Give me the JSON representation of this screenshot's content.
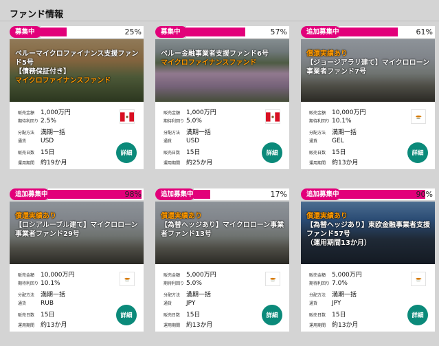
{
  "page_title": "ファンド情報",
  "detail_label": "詳細",
  "cards": [
    {
      "status": "募集中",
      "progress": 25,
      "progress_label": "25%",
      "caption_white_1": "ペルーマイクロファイナンス支援ファンド5号",
      "caption_white_2": "【債務保証付き】",
      "caption_orange_top": "",
      "caption_orange_bottom": "マイクロファイナンスファンド",
      "flag": "peru-flag",
      "rows": [
        {
          "key": "販売金額",
          "value": "1,000万円"
        },
        {
          "key": "期待利回り",
          "value": "2.5%"
        },
        {
          "key": "分配方法",
          "value": "満期一括"
        },
        {
          "key": "通貨",
          "value": "USD"
        },
        {
          "key": "販売日数",
          "value": "15日"
        },
        {
          "key": "運用期間",
          "value": "約19か月"
        }
      ]
    },
    {
      "status": "募集中",
      "progress": 57,
      "progress_label": "57%",
      "caption_white_1": "ペルー金融事業者支援ファンド6号",
      "caption_white_2": "",
      "caption_orange_top": "",
      "caption_orange_bottom": "マイクロファイナンスファンド",
      "flag": "peru-flag",
      "rows": [
        {
          "key": "販売金額",
          "value": "1,000万円"
        },
        {
          "key": "期待利回り",
          "value": "5.0%"
        },
        {
          "key": "分配方法",
          "value": "満期一括"
        },
        {
          "key": "通貨",
          "value": "USD"
        },
        {
          "key": "販売日数",
          "value": "15日"
        },
        {
          "key": "運用期間",
          "value": "約25か月"
        }
      ]
    },
    {
      "status": "追加募集中",
      "progress": 61,
      "progress_label": "61%",
      "caption_orange_top": "償還実績あり",
      "caption_white_1": "【ジョージアラリ建て】マイクロローン事業者ファンド7号",
      "caption_white_2": "",
      "caption_orange_bottom": "",
      "flag": "cyprus-flag",
      "rows": [
        {
          "key": "販売金額",
          "value": "10,000万円"
        },
        {
          "key": "期待利回り",
          "value": "10.1%"
        },
        {
          "key": "分配方法",
          "value": "満期一括"
        },
        {
          "key": "通貨",
          "value": "GEL"
        },
        {
          "key": "販売日数",
          "value": "15日"
        },
        {
          "key": "運用期間",
          "value": "約13か月"
        }
      ]
    },
    {
      "status": "追加募集中",
      "progress": 98,
      "progress_label": "98%",
      "caption_orange_top": "償還実績あり",
      "caption_white_1": "【ロシアルーブル建て】マイクロローン事業者ファンド29号",
      "caption_white_2": "",
      "caption_orange_bottom": "",
      "flag": "cyprus-flag",
      "rows": [
        {
          "key": "販売金額",
          "value": "10,000万円"
        },
        {
          "key": "期待利回り",
          "value": "10.1%"
        },
        {
          "key": "分配方法",
          "value": "満期一括"
        },
        {
          "key": "通貨",
          "value": "RUB"
        },
        {
          "key": "販売日数",
          "value": "15日"
        },
        {
          "key": "運用期間",
          "value": "約13か月"
        }
      ]
    },
    {
      "status": "追加募集中",
      "progress": 17,
      "progress_label": "17%",
      "caption_orange_top": "償還実績あり",
      "caption_white_1": "【為替ヘッジあり】マイクロローン事業者ファンド13号",
      "caption_white_2": "",
      "caption_orange_bottom": "",
      "flag": "cyprus-flag",
      "rows": [
        {
          "key": "販売金額",
          "value": "5,000万円"
        },
        {
          "key": "期待利回り",
          "value": "5.0%"
        },
        {
          "key": "分配方法",
          "value": "満期一括"
        },
        {
          "key": "通貨",
          "value": "JPY"
        },
        {
          "key": "販売日数",
          "value": "15日"
        },
        {
          "key": "運用期間",
          "value": "約13か月"
        }
      ]
    },
    {
      "status": "追加募集中",
      "progress": 90,
      "progress_label": "90%",
      "caption_orange_top": "償還実績あり",
      "caption_white_1": "【為替ヘッジあり】東欧金融事業者支援ファンド57号",
      "caption_white_2": "（運用期間13か月）",
      "caption_orange_bottom": "",
      "flag": "cyprus-flag",
      "rows": [
        {
          "key": "販売金額",
          "value": "5,000万円"
        },
        {
          "key": "期待利回り",
          "value": "7.0%"
        },
        {
          "key": "分配方法",
          "value": "満期一括"
        },
        {
          "key": "通貨",
          "value": "JPY"
        },
        {
          "key": "販売日数",
          "value": "15日"
        },
        {
          "key": "運用期間",
          "value": "約13か月"
        }
      ]
    }
  ]
}
